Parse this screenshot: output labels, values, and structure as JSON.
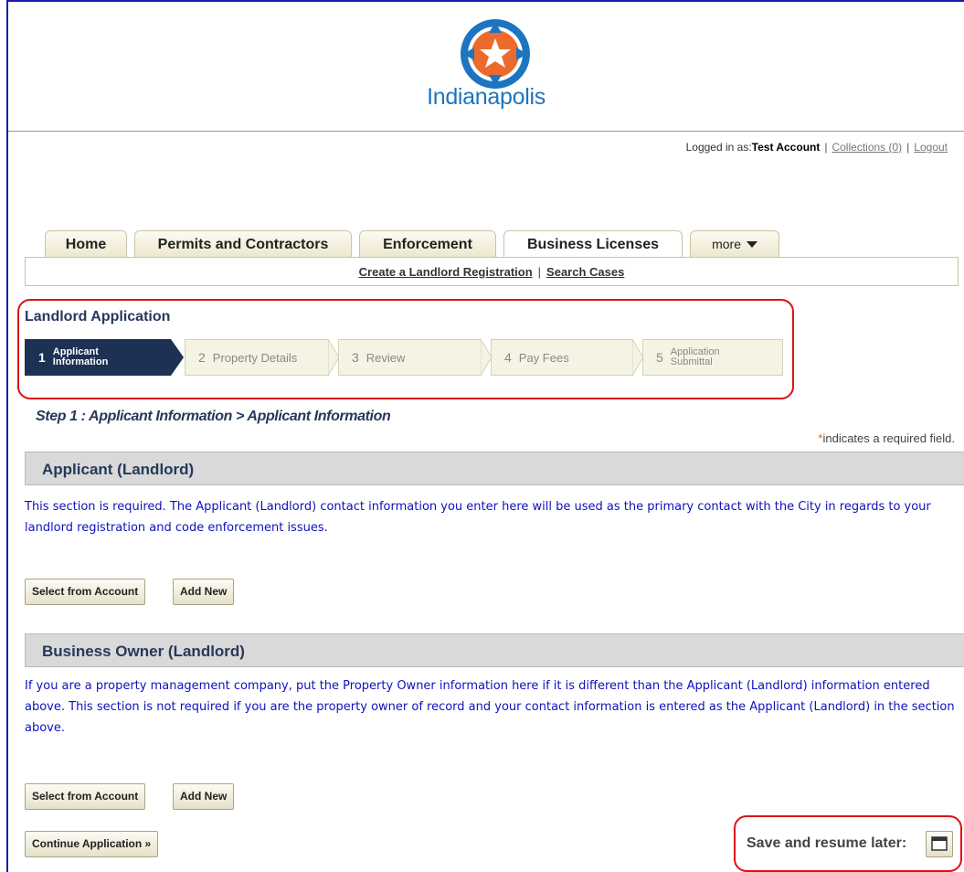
{
  "header": {
    "logo_text": "Indianapolis",
    "colors": {
      "logo_orange": "#ec6a2c",
      "logo_blue": "#1d74c1"
    }
  },
  "login_bar": {
    "prefix": "Logged in as:",
    "user": "Test Account",
    "collections": "Collections (0)",
    "logout": "Logout",
    "separator": "|"
  },
  "tabs": [
    {
      "label": "Home"
    },
    {
      "label": "Permits and Contractors"
    },
    {
      "label": "Enforcement"
    },
    {
      "label": "Business Licenses",
      "active": true
    },
    {
      "label": "more",
      "icon": "caret-down-icon"
    }
  ],
  "subnav": {
    "link1": "Create a Landlord Registration",
    "separator": "|",
    "link2": "Search Cases"
  },
  "application": {
    "title": "Landlord Application",
    "steps": [
      {
        "num": "1",
        "line1": "Applicant",
        "line2": "Information",
        "active": true
      },
      {
        "num": "2",
        "label": "Property Details"
      },
      {
        "num": "3",
        "label": "Review"
      },
      {
        "num": "4",
        "label": "Pay Fees"
      },
      {
        "num": "5",
        "line1": "Application",
        "line2": "Submittal"
      }
    ]
  },
  "step_heading": "Step 1 : Applicant Information > Applicant Information",
  "required_note": {
    "star": "*",
    "text": "indicates a required field."
  },
  "sections": {
    "applicant": {
      "title": "Applicant (Landlord)",
      "text": "This section is required. The Applicant (Landlord) contact information you enter here will be used as the primary contact with the City in regards to your landlord registration and code enforcement issues.",
      "btn_select": "Select from Account",
      "btn_add": "Add New"
    },
    "owner": {
      "title": "Business Owner (Landlord)",
      "text": "If you are a property management company, put the Property Owner information here if it is different than the Applicant (Landlord) information entered above. This section is not required if you are the property owner of record and your contact information is entered as the Applicant (Landlord) in the section above.",
      "btn_select": "Select from Account",
      "btn_add": "Add New"
    }
  },
  "continue_button": "Continue Application »",
  "save_resume": {
    "label": "Save and resume later:",
    "icon": "save-window-icon"
  }
}
